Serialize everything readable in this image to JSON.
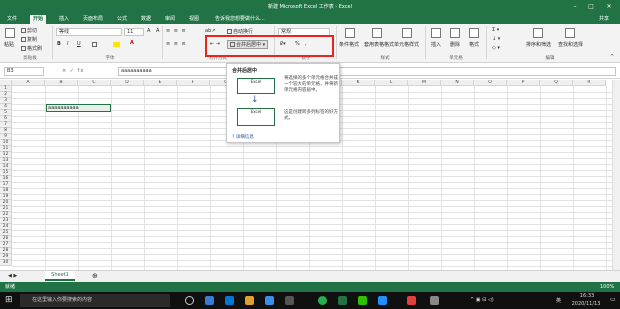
{
  "window": {
    "title": "新建 Microsoft Excel 工作表 - Excel",
    "user": "共享"
  },
  "tabs": [
    "文件",
    "开始",
    "插入",
    "页面布局",
    "公式",
    "数据",
    "审阅",
    "视图"
  ],
  "tell_me": "告诉我您想要做什么...",
  "ribbon": {
    "clipboard": {
      "paste": "粘贴",
      "cut": "剪切",
      "copy": "复制",
      "format_painter": "格式刷",
      "group": "剪贴板"
    },
    "font": {
      "name": "等线",
      "size": "11",
      "group": "字体"
    },
    "alignment": {
      "wrap": "自动换行",
      "merge": "合并后居中",
      "group": "对齐方式"
    },
    "number": {
      "format": "常规",
      "group": "数字"
    },
    "styles": {
      "conditional": "条件格式",
      "table": "套用表格格式",
      "cell": "单元格样式",
      "group": "样式"
    },
    "cells": {
      "insert": "插入",
      "delete": "删除",
      "format": "格式",
      "group": "单元格"
    },
    "editing": {
      "sort": "排序和筛选",
      "find": "查找和选择",
      "group": "编辑"
    }
  },
  "formula_bar": {
    "name_box": "B3",
    "fx": "× ✓ fx",
    "content": "aaaaaaaaaa"
  },
  "columns": [
    "A",
    "B",
    "C",
    "D",
    "E",
    "F",
    "G",
    "H",
    "I",
    "J",
    "K",
    "L",
    "M",
    "N",
    "O",
    "P",
    "Q",
    "R"
  ],
  "rows": [
    "1",
    "2",
    "3",
    "4",
    "5",
    "6",
    "7",
    "8",
    "9",
    "10",
    "11",
    "12",
    "13",
    "14",
    "15",
    "16",
    "17",
    "18",
    "19",
    "20",
    "21",
    "22",
    "23",
    "24",
    "25",
    "26",
    "27",
    "28",
    "29",
    "30"
  ],
  "cell_b3": "aaaaaaaaaa",
  "tooltip": {
    "title": "合并后居中",
    "desc": "将选择的多个单元格合并成一个较大的单元格，并将新单元格内容居中。",
    "desc2": "这是创建跨多列标签的好方式。",
    "more": "详细信息",
    "excel_label": "Excel"
  },
  "sheet": {
    "tab": "Sheet1"
  },
  "status": {
    "ready": "就绪",
    "zoom": "100%"
  },
  "taskbar": {
    "search": "在这里输入你要搜索的内容",
    "time": "16:33",
    "date": "2020/11/13",
    "lang": "英"
  },
  "colors": {
    "excel_green": "#217346",
    "highlight_red": "#e8261d"
  }
}
